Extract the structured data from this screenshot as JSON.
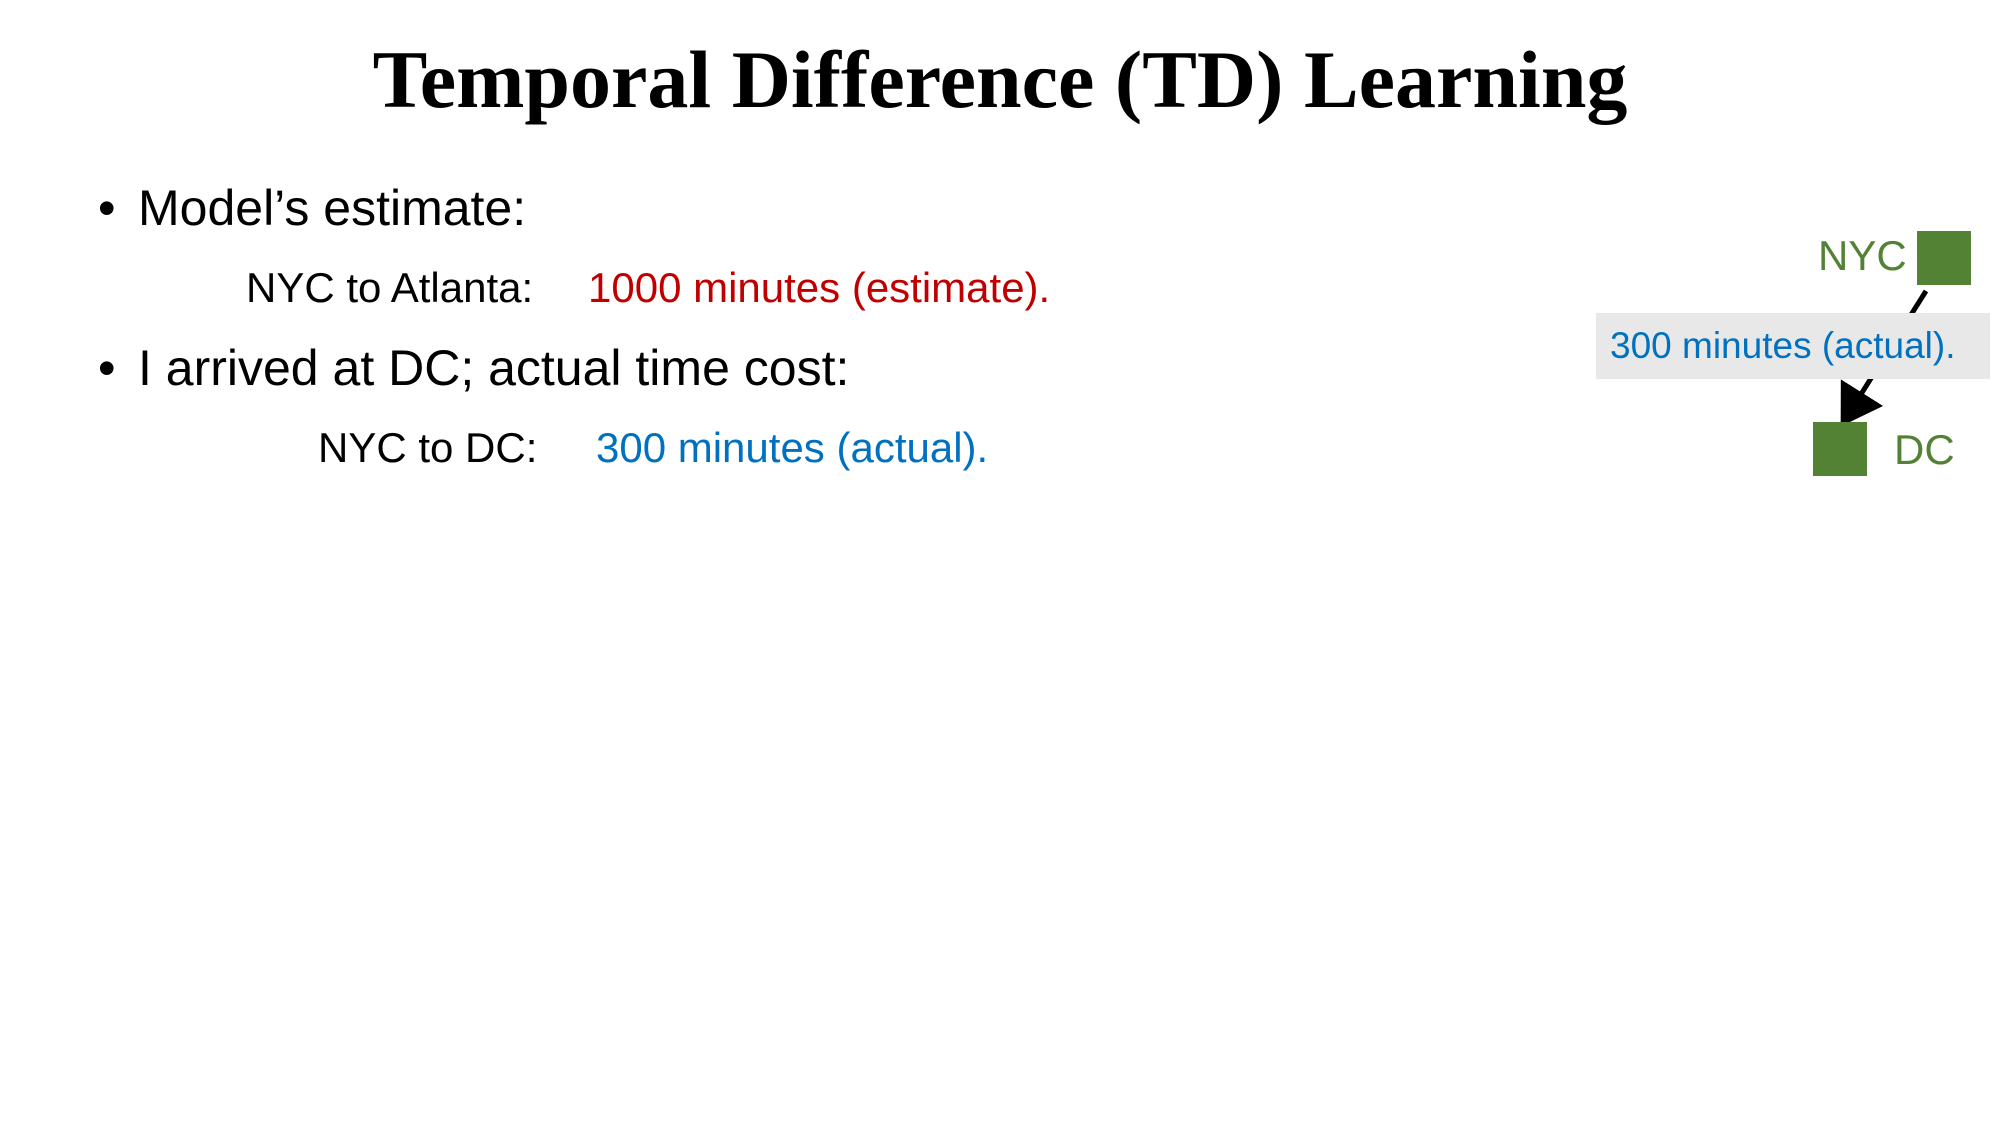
{
  "slide": {
    "title": "Temporal Difference (TD) Learning"
  },
  "bullets": [
    {
      "marker": "•",
      "text": "Model’s estimate:",
      "detail": {
        "label": "NYC to Atlanta:",
        "value": "1000 minutes (estimate)."
      }
    },
    {
      "marker": "•",
      "text": "I arrived at DC; actual time cost:",
      "detail": {
        "label": "NYC to DC:",
        "value": "300 minutes (actual)."
      }
    }
  ],
  "diagram": {
    "from_city": "NYC",
    "to_city": "DC",
    "edge_label": "300 minutes (actual).",
    "colors": {
      "city": "#548235",
      "estimate": "#c00000",
      "actual": "#0070c0",
      "edge_label_bg": "#e8e8e8"
    }
  }
}
